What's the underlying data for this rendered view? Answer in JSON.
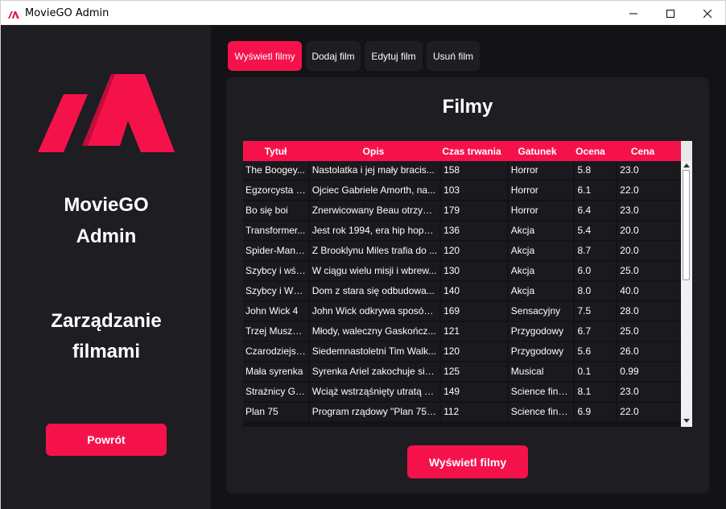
{
  "window": {
    "title": "MovieGO Admin"
  },
  "sidebar": {
    "app_name_line1": "MovieGO",
    "app_name_line2": "Admin",
    "subtitle_line1": "Zarządzanie",
    "subtitle_line2": "filmami",
    "back_label": "Powrót"
  },
  "colors": {
    "accent": "#f5124a",
    "sidebar_bg": "#1e1d22",
    "main_bg": "#131216"
  },
  "tabs": [
    {
      "label": "Wyświetl filmy",
      "active": true
    },
    {
      "label": "Dodaj film",
      "active": false
    },
    {
      "label": "Edytuj film",
      "active": false
    },
    {
      "label": "Usuń film",
      "active": false
    }
  ],
  "panel": {
    "heading": "Filmy",
    "show_button_label": "Wyświetl filmy"
  },
  "table": {
    "columns": [
      "Tytuł",
      "Opis",
      "Czas trwania",
      "Gatunek",
      "Ocena",
      "Cena"
    ],
    "rows": [
      [
        "The Boogey...",
        "Nastolatka i jej mały bracis...",
        "158",
        "Horror",
        "5.8",
        "23.0"
      ],
      [
        "Egzorcysta p...",
        "Ojciec Gabriele Amorth, na...",
        "103",
        "Horror",
        "6.1",
        "22.0"
      ],
      [
        "Bo się boi",
        "Znerwicowany Beau otrzym...",
        "179",
        "Horror",
        "6.4",
        "23.0"
      ],
      [
        "Transformer...",
        "Jest rok 1994, era hip hopu ...",
        "136",
        "Akcja",
        "5.4",
        "20.0"
      ],
      [
        "Spider-Man:...",
        "Z Brooklynu Miles trafia do ...",
        "120",
        "Akcja",
        "8.7",
        "20.0"
      ],
      [
        "Szybcy i wśc...",
        "W ciągu wielu misji i wbrew...",
        "130",
        "Akcja",
        "6.0",
        "25.0"
      ],
      [
        "Szybcy i Wś...",
        "Dom z stara się odbudowa...",
        "140",
        "Akcja",
        "8.0",
        "40.0"
      ],
      [
        "John Wick 4",
        "John Wick odkrywa sposób...",
        "169",
        "Sensacyjny",
        "7.5",
        "28.0"
      ],
      [
        "Trzej Muszki...",
        "Młody, waleczny Gaskończ...",
        "121",
        "Przygodowy",
        "6.7",
        "25.0"
      ],
      [
        "Czarodziejsk...",
        "Siedemnastoletni Tim Walk...",
        "120",
        "Przygodowy",
        "5.6",
        "26.0"
      ],
      [
        "Mała syrenka",
        "Syrenka Ariel zakochuje się ...",
        "125",
        "Musical",
        "0.1",
        "0.99"
      ],
      [
        "Strażnicy Ga...",
        "Wciąż wstrząśnięty utratą G...",
        "149",
        "Science finct...",
        "8.1",
        "23.0"
      ],
      [
        "Plan 75",
        "Program rządowy \"Plan 75\"...",
        "112",
        "Science finct...",
        "6.9",
        "22.0"
      ]
    ]
  }
}
